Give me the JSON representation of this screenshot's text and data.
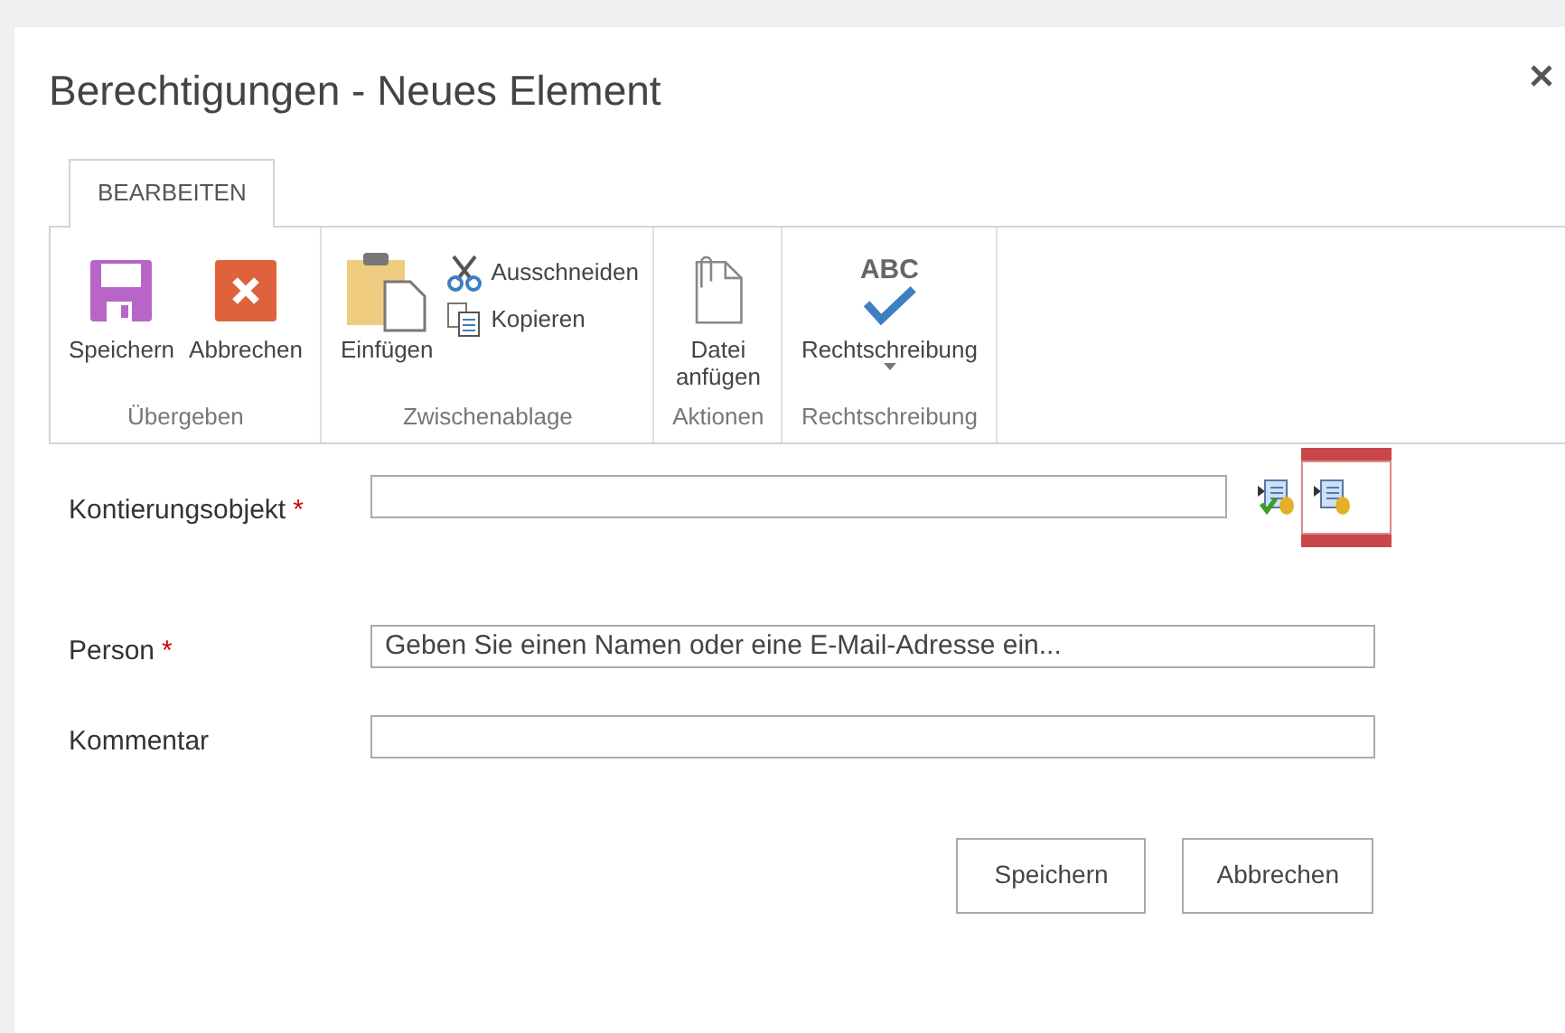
{
  "window": {
    "title": "Berechtigungen - Neues Element"
  },
  "ribbon_tabs": [
    {
      "label": "BEARBEITEN",
      "selected": true
    }
  ],
  "ribbon_groups": [
    {
      "label": "Übergeben",
      "items": [
        {
          "kind": "save",
          "label": "Speichern"
        },
        {
          "kind": "cancel",
          "label": "Abbrechen"
        }
      ]
    },
    {
      "label": "Zwischenablage",
      "items": [
        {
          "kind": "paste",
          "label": "Einfügen"
        },
        {
          "kind": "cut",
          "label": "Ausschneiden"
        },
        {
          "kind": "copy",
          "label": "Kopieren"
        }
      ]
    },
    {
      "label": "Aktionen",
      "items": [
        {
          "kind": "attach",
          "label": "Datei anfügen"
        }
      ]
    },
    {
      "label": "Rechtschreibung",
      "items": [
        {
          "kind": "spell",
          "label": "Rechtschreibung",
          "icon_text": "ABC"
        }
      ]
    }
  ],
  "fields": [
    {
      "label": "Kontierungsobjekt",
      "required_mark": "*",
      "kind": "lookup",
      "lookup_icons": [
        {
          "kind": "checked",
          "selected": false
        },
        {
          "kind": "plain",
          "selected": true
        }
      ]
    },
    {
      "label": "Person",
      "required_mark": "*",
      "kind": "people",
      "placeholder": "Geben Sie einen Namen oder eine E-Mail-Adresse ein..."
    },
    {
      "label": "Kommentar",
      "kind": "text"
    }
  ],
  "buttons": [
    "Speichern",
    "Abbrechen"
  ]
}
